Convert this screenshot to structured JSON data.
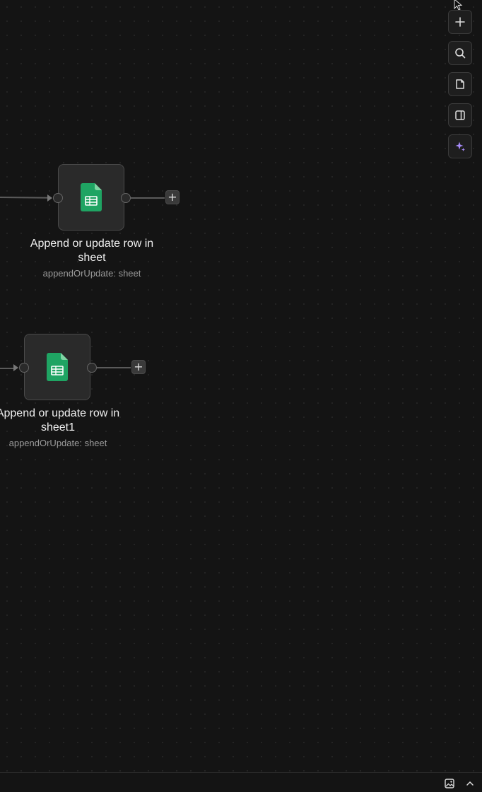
{
  "toolbar": {
    "buttons": [
      {
        "name": "add-node-button",
        "icon": "plus-icon"
      },
      {
        "name": "search-button",
        "icon": "search-icon"
      },
      {
        "name": "sticky-note-button",
        "icon": "note-icon"
      },
      {
        "name": "toggle-panel-button",
        "icon": "panel-icon"
      },
      {
        "name": "ai-assistant-button",
        "icon": "sparkle-icon",
        "color": "#a78bfa"
      }
    ]
  },
  "nodes": [
    {
      "title_line1": "Append or update row in",
      "title_line2": "sheet",
      "subtitle": "appendOrUpdate: sheet",
      "icon": "google-sheets-icon"
    },
    {
      "title_line1": "Append or update row in",
      "title_line2": "sheet1",
      "subtitle": "appendOrUpdate: sheet",
      "icon": "google-sheets-icon"
    }
  ],
  "add_button_label": "+",
  "colors": {
    "background": "#141414",
    "sheets_green": "#1fa463",
    "accent_purple": "#a78bfa"
  }
}
